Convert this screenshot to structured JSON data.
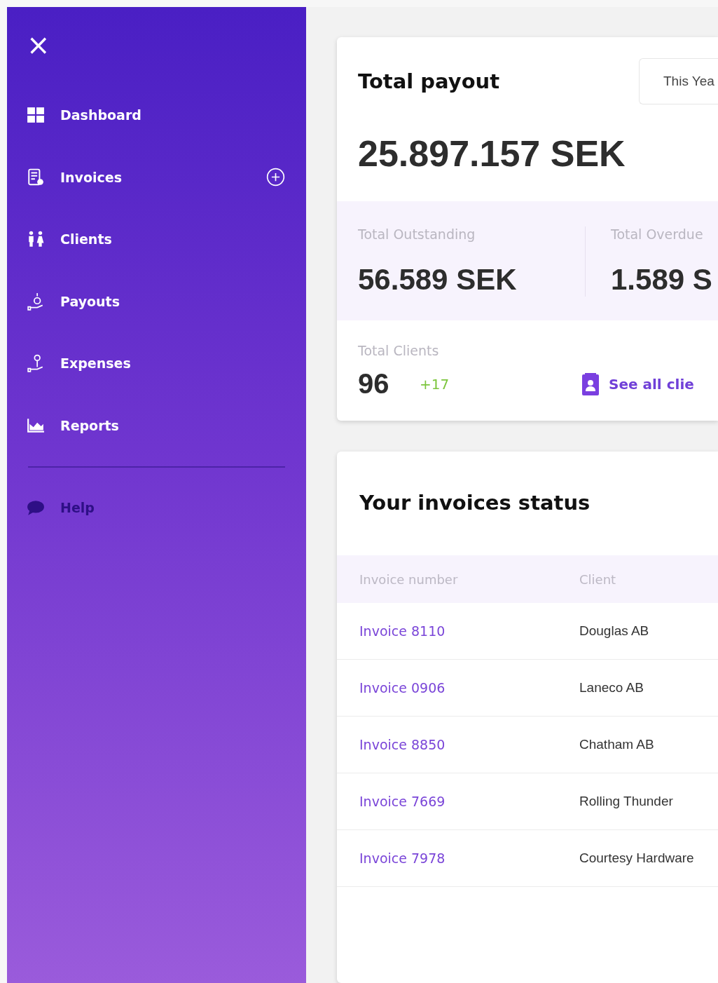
{
  "sidebar": {
    "close_label": "×",
    "items": [
      {
        "kind": "grid",
        "label": "Dashboard",
        "add_button": false,
        "disabled": false
      },
      {
        "kind": "invoice",
        "label": "Invoices",
        "add_button": true,
        "disabled": false
      },
      {
        "kind": "people",
        "label": "Clients",
        "add_button": false,
        "disabled": false
      },
      {
        "kind": "coin-hand",
        "label": "Payouts",
        "add_button": false,
        "disabled": false
      },
      {
        "kind": "pin-hand",
        "label": "Expenses",
        "add_button": false,
        "disabled": false
      },
      {
        "kind": "chart",
        "label": "Reports",
        "add_button": false,
        "disabled": false
      }
    ],
    "footer_items": [
      {
        "kind": "chat",
        "label": "Help",
        "disabled": true
      }
    ]
  },
  "payout_card": {
    "title": "Total payout",
    "period": "This Yea",
    "total": "25.897.157 SEK",
    "stats": [
      {
        "label": "Total Outstanding",
        "value": "56.589 SEK"
      },
      {
        "label": "Total Overdue",
        "value": "1.589 S"
      }
    ],
    "clients": {
      "label": "Total Clients",
      "value": "96",
      "change": "+17",
      "link": "See all clie"
    }
  },
  "invoices_card": {
    "title": "Your invoices status",
    "columns": [
      "Invoice number",
      "Client"
    ],
    "rows": [
      {
        "invoice": "Invoice 8110",
        "client": "Douglas AB"
      },
      {
        "invoice": "Invoice 0906",
        "client": "Laneco AB"
      },
      {
        "invoice": "Invoice 8850",
        "client": "Chatham AB"
      },
      {
        "invoice": "Invoice 7669",
        "client": "Rolling Thunder"
      },
      {
        "invoice": "Invoice 7978",
        "client": "Courtesy Hardware"
      }
    ]
  }
}
